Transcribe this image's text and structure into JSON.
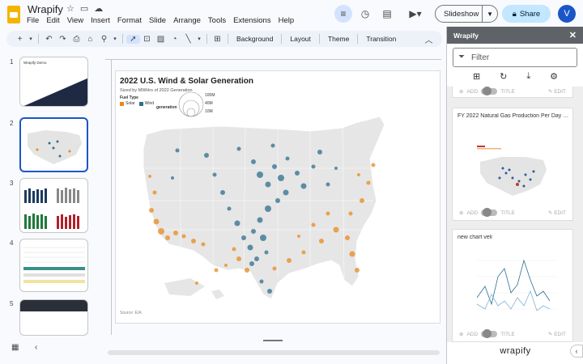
{
  "app": {
    "title": "Wrapify",
    "menus": [
      "File",
      "Edit",
      "View",
      "Insert",
      "Format",
      "Slide",
      "Arrange",
      "Tools",
      "Extensions",
      "Help"
    ]
  },
  "top_right": {
    "slideshow_label": "Slideshow",
    "share_label": "Share",
    "avatar_initial": "V"
  },
  "toolbar": {
    "background_label": "Background",
    "layout_label": "Layout",
    "theme_label": "Theme",
    "transition_label": "Transition"
  },
  "filmstrip": {
    "slides": [
      {
        "num": "1",
        "title": "Wrapify Demo"
      },
      {
        "num": "2",
        "title": ""
      },
      {
        "num": "3",
        "title": ""
      },
      {
        "num": "4",
        "title": ""
      },
      {
        "num": "5",
        "title": ""
      }
    ]
  },
  "slide": {
    "title": "2022 U.S. Wind & Solar Generation",
    "subtitle": "Sized by MWHrs of 2022 Generation",
    "legend_header": "Fuel Type",
    "legend_solar": "Solar",
    "legend_wind": "Wind",
    "size_header": "generation",
    "size_labels": [
      "100M",
      "40M",
      "10M"
    ],
    "source": "Source: EIA",
    "colors": {
      "solar": "#e8891c",
      "wind": "#2e6e8e",
      "land": "#e6e6e6"
    }
  },
  "panel": {
    "title": "Wrapify",
    "filter_placeholder": "Filter",
    "add_label": "ADD",
    "title_label": "TITLE",
    "edit_label": "EDIT",
    "cards": [
      {
        "title": "FY 2022 Natural Gas Production Per Day on..."
      },
      {
        "title": "new chart veli"
      }
    ],
    "footer": "wrapify"
  }
}
